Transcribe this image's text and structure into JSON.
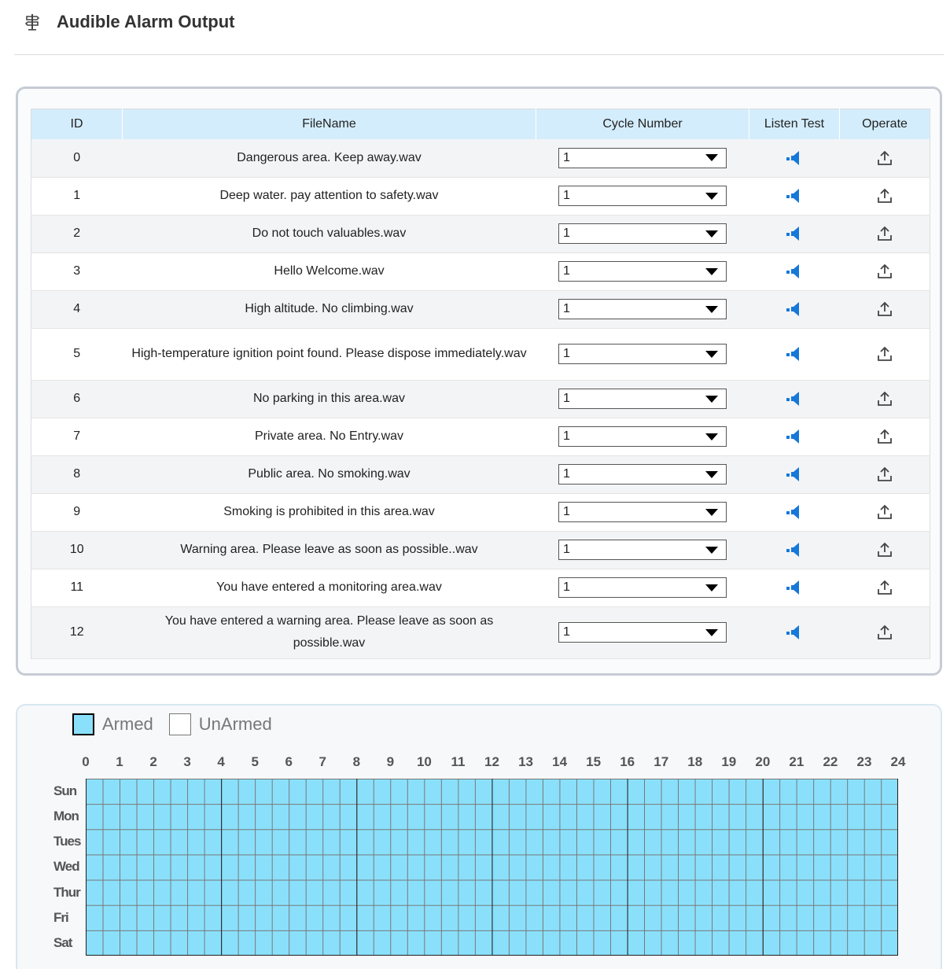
{
  "header": {
    "title": "Audible Alarm Output",
    "icon": "signpost-icon"
  },
  "table": {
    "columns": [
      "ID",
      "FileName",
      "Cycle Number",
      "Listen Test",
      "Operate"
    ],
    "rows": [
      {
        "id": "0",
        "filename": "Dangerous area. Keep away.wav",
        "cycle": "1"
      },
      {
        "id": "1",
        "filename": "Deep water. pay attention to safety.wav",
        "cycle": "1"
      },
      {
        "id": "2",
        "filename": "Do not touch valuables.wav",
        "cycle": "1"
      },
      {
        "id": "3",
        "filename": "Hello Welcome.wav",
        "cycle": "1"
      },
      {
        "id": "4",
        "filename": "High altitude. No climbing.wav",
        "cycle": "1"
      },
      {
        "id": "5",
        "filename": "High-temperature ignition point found. Please dispose immediately.wav",
        "cycle": "1"
      },
      {
        "id": "6",
        "filename": "No parking in this area.wav",
        "cycle": "1"
      },
      {
        "id": "7",
        "filename": "Private area. No Entry.wav",
        "cycle": "1"
      },
      {
        "id": "8",
        "filename": "Public area. No smoking.wav",
        "cycle": "1"
      },
      {
        "id": "9",
        "filename": "Smoking is prohibited in this area.wav",
        "cycle": "1"
      },
      {
        "id": "10",
        "filename": "Warning area. Please leave as soon as possible..wav",
        "cycle": "1"
      },
      {
        "id": "11",
        "filename": "You have entered a monitoring area.wav",
        "cycle": "1"
      },
      {
        "id": "12",
        "filename": "You have entered a warning area. Please leave as soon as possible.wav",
        "cycle": "1"
      }
    ],
    "listen_icon": "speaker-icon",
    "operate_icon": "upload-icon"
  },
  "schedule": {
    "legend": {
      "armed": "Armed",
      "unarmed": "UnArmed"
    },
    "hours": [
      "0",
      "1",
      "2",
      "3",
      "4",
      "5",
      "6",
      "7",
      "8",
      "9",
      "10",
      "11",
      "12",
      "13",
      "14",
      "15",
      "16",
      "17",
      "18",
      "19",
      "20",
      "21",
      "22",
      "23",
      "24"
    ],
    "days": [
      "Sun",
      "Mon",
      "Tues",
      "Wed",
      "Thur",
      "Fri",
      "Sat"
    ],
    "armed_fraction": 1.0,
    "colors": {
      "armed": "#8ae0fb",
      "unarmed": "#ffffff"
    }
  }
}
